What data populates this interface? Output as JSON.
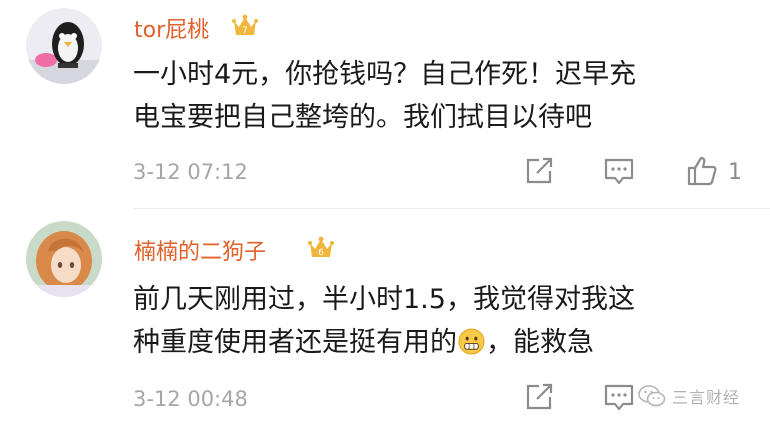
{
  "comments": [
    {
      "username": "tor屁桃",
      "vip_level": "7",
      "text_line1": "一小时4元，你抢钱吗？自己作死！迟早充",
      "text_line2": "电宝要把自己整垮的。我们拭目以待吧",
      "time": "3-12 07:12",
      "likes": "1",
      "avatar_icon": "penguin-toy-avatar"
    },
    {
      "username": "楠楠的二狗子",
      "vip_level": "6",
      "text_line1": "前几天刚用过，半小时1.5，我觉得对我这",
      "text_line2_before": "种重度使用者还是挺有用的",
      "text_line2_after": "，能救急",
      "emoji": "grimace-emoji",
      "time": "3-12 00:48",
      "avatar_icon": "anime-girl-avatar"
    }
  ],
  "watermark": {
    "text": "三言财经",
    "icon": "wechat-icon"
  },
  "colors": {
    "username": "#e1602a",
    "time": "#a6a6a6",
    "text": "#1a1a1a",
    "vip": "#f1b73c"
  }
}
